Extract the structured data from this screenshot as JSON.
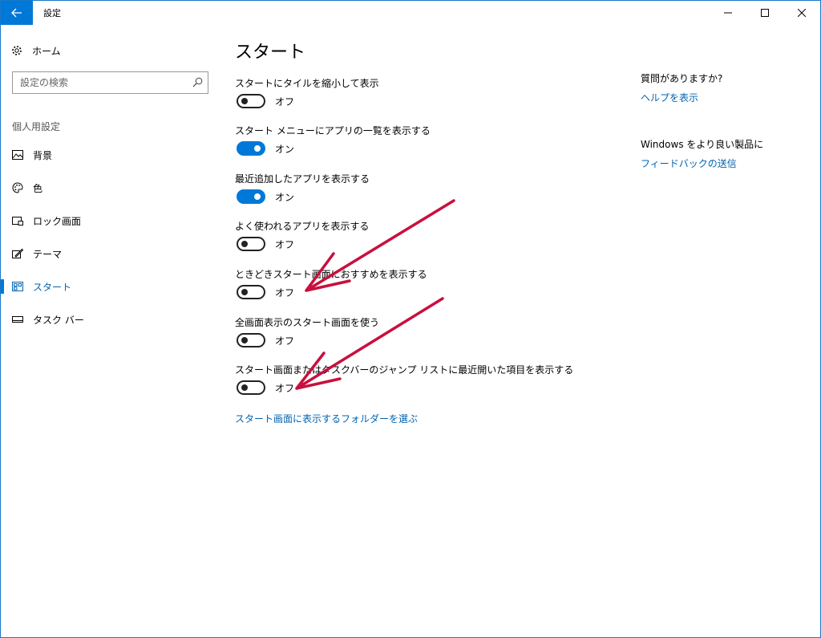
{
  "window": {
    "title": "設定",
    "controls": [
      "minimize-icon",
      "maximize-icon",
      "close-icon"
    ]
  },
  "sidebar": {
    "home_label": "ホーム",
    "search_placeholder": "設定の検索",
    "section_label": "個人用設定",
    "items": [
      {
        "label": "背景",
        "icon": "picture-icon"
      },
      {
        "label": "色",
        "icon": "palette-icon"
      },
      {
        "label": "ロック画面",
        "icon": "lock-screen-icon"
      },
      {
        "label": "テーマ",
        "icon": "theme-icon"
      },
      {
        "label": "スタート",
        "icon": "start-icon",
        "selected": true
      },
      {
        "label": "タスク バー",
        "icon": "taskbar-icon"
      }
    ]
  },
  "main": {
    "title": "スタート",
    "settings": [
      {
        "label": "スタートにタイルを縮小して表示",
        "state": "オフ",
        "on": false
      },
      {
        "label": "スタート メニューにアプリの一覧を表示する",
        "state": "オン",
        "on": true
      },
      {
        "label": "最近追加したアプリを表示する",
        "state": "オン",
        "on": true
      },
      {
        "label": "よく使われるアプリを表示する",
        "state": "オフ",
        "on": false
      },
      {
        "label": "ときどきスタート画面におすすめを表示する",
        "state": "オフ",
        "on": false
      },
      {
        "label": "全画面表示のスタート画面を使う",
        "state": "オフ",
        "on": false
      },
      {
        "label": "スタート画面またはタスクバーのジャンプ リストに最近開いた項目を表示する",
        "state": "オフ",
        "on": false
      }
    ],
    "folder_link": "スタート画面に表示するフォルダーを選ぶ"
  },
  "right_panel": {
    "question": "質問がありますか?",
    "help_link": "ヘルプを表示",
    "windows_better": "Windows をより良い製品に",
    "feedback_link": "フィードバックの送信"
  },
  "colors": {
    "accent": "#0078d7",
    "link": "#0063b1",
    "annotation": "#c8103e"
  }
}
